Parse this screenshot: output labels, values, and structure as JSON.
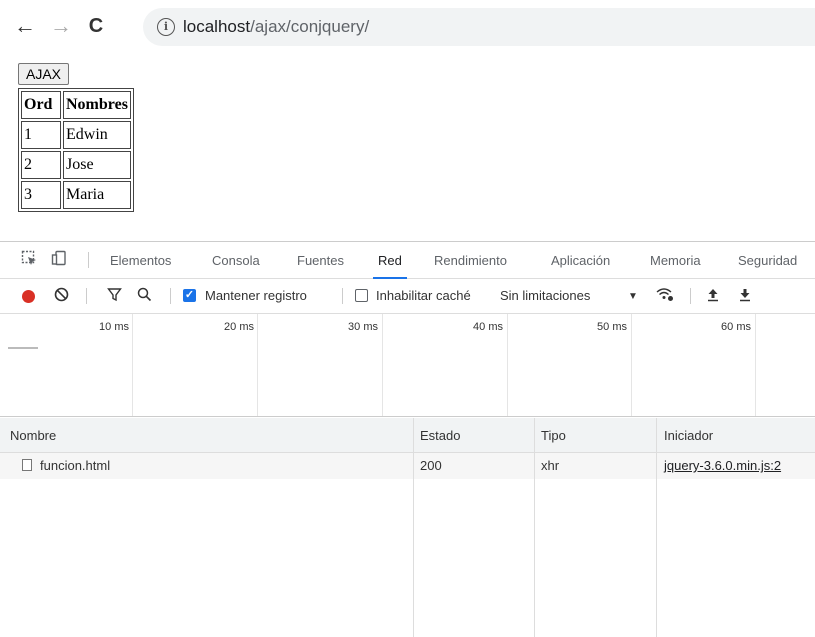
{
  "browser": {
    "url_host": "localhost",
    "url_path": "/ajax/conjquery/",
    "back_glyph": "←",
    "forward_glyph": "→",
    "reload_glyph": "C",
    "info_glyph": "i"
  },
  "page": {
    "button_label": "AJAX",
    "table": {
      "headers": [
        "Ord",
        "Nombres"
      ],
      "rows": [
        [
          "1",
          "Edwin"
        ],
        [
          "2",
          "Jose"
        ],
        [
          "3",
          "Maria"
        ]
      ]
    }
  },
  "devtools": {
    "tabs": [
      "Elementos",
      "Consola",
      "Fuentes",
      "Red",
      "Rendimiento",
      "Aplicación",
      "Memoria",
      "Seguridad"
    ],
    "active_tab": "Red",
    "toolbar": {
      "preserve_log_label": "Mantener registro",
      "preserve_log_checked": true,
      "disable_cache_label": "Inhabilitar caché",
      "disable_cache_checked": false,
      "throttling_value": "Sin limitaciones"
    },
    "timeline_ticks": [
      "10 ms",
      "20 ms",
      "30 ms",
      "40 ms",
      "50 ms",
      "60 ms"
    ],
    "columns": [
      "Nombre",
      "Estado",
      "Tipo",
      "Iniciador"
    ],
    "requests": [
      {
        "name": "funcion.html",
        "status": "200",
        "type": "xhr",
        "initiator": "jquery-3.6.0.min.js:2"
      }
    ],
    "accent_color": "#1a73e8",
    "record_color": "#d93025"
  }
}
